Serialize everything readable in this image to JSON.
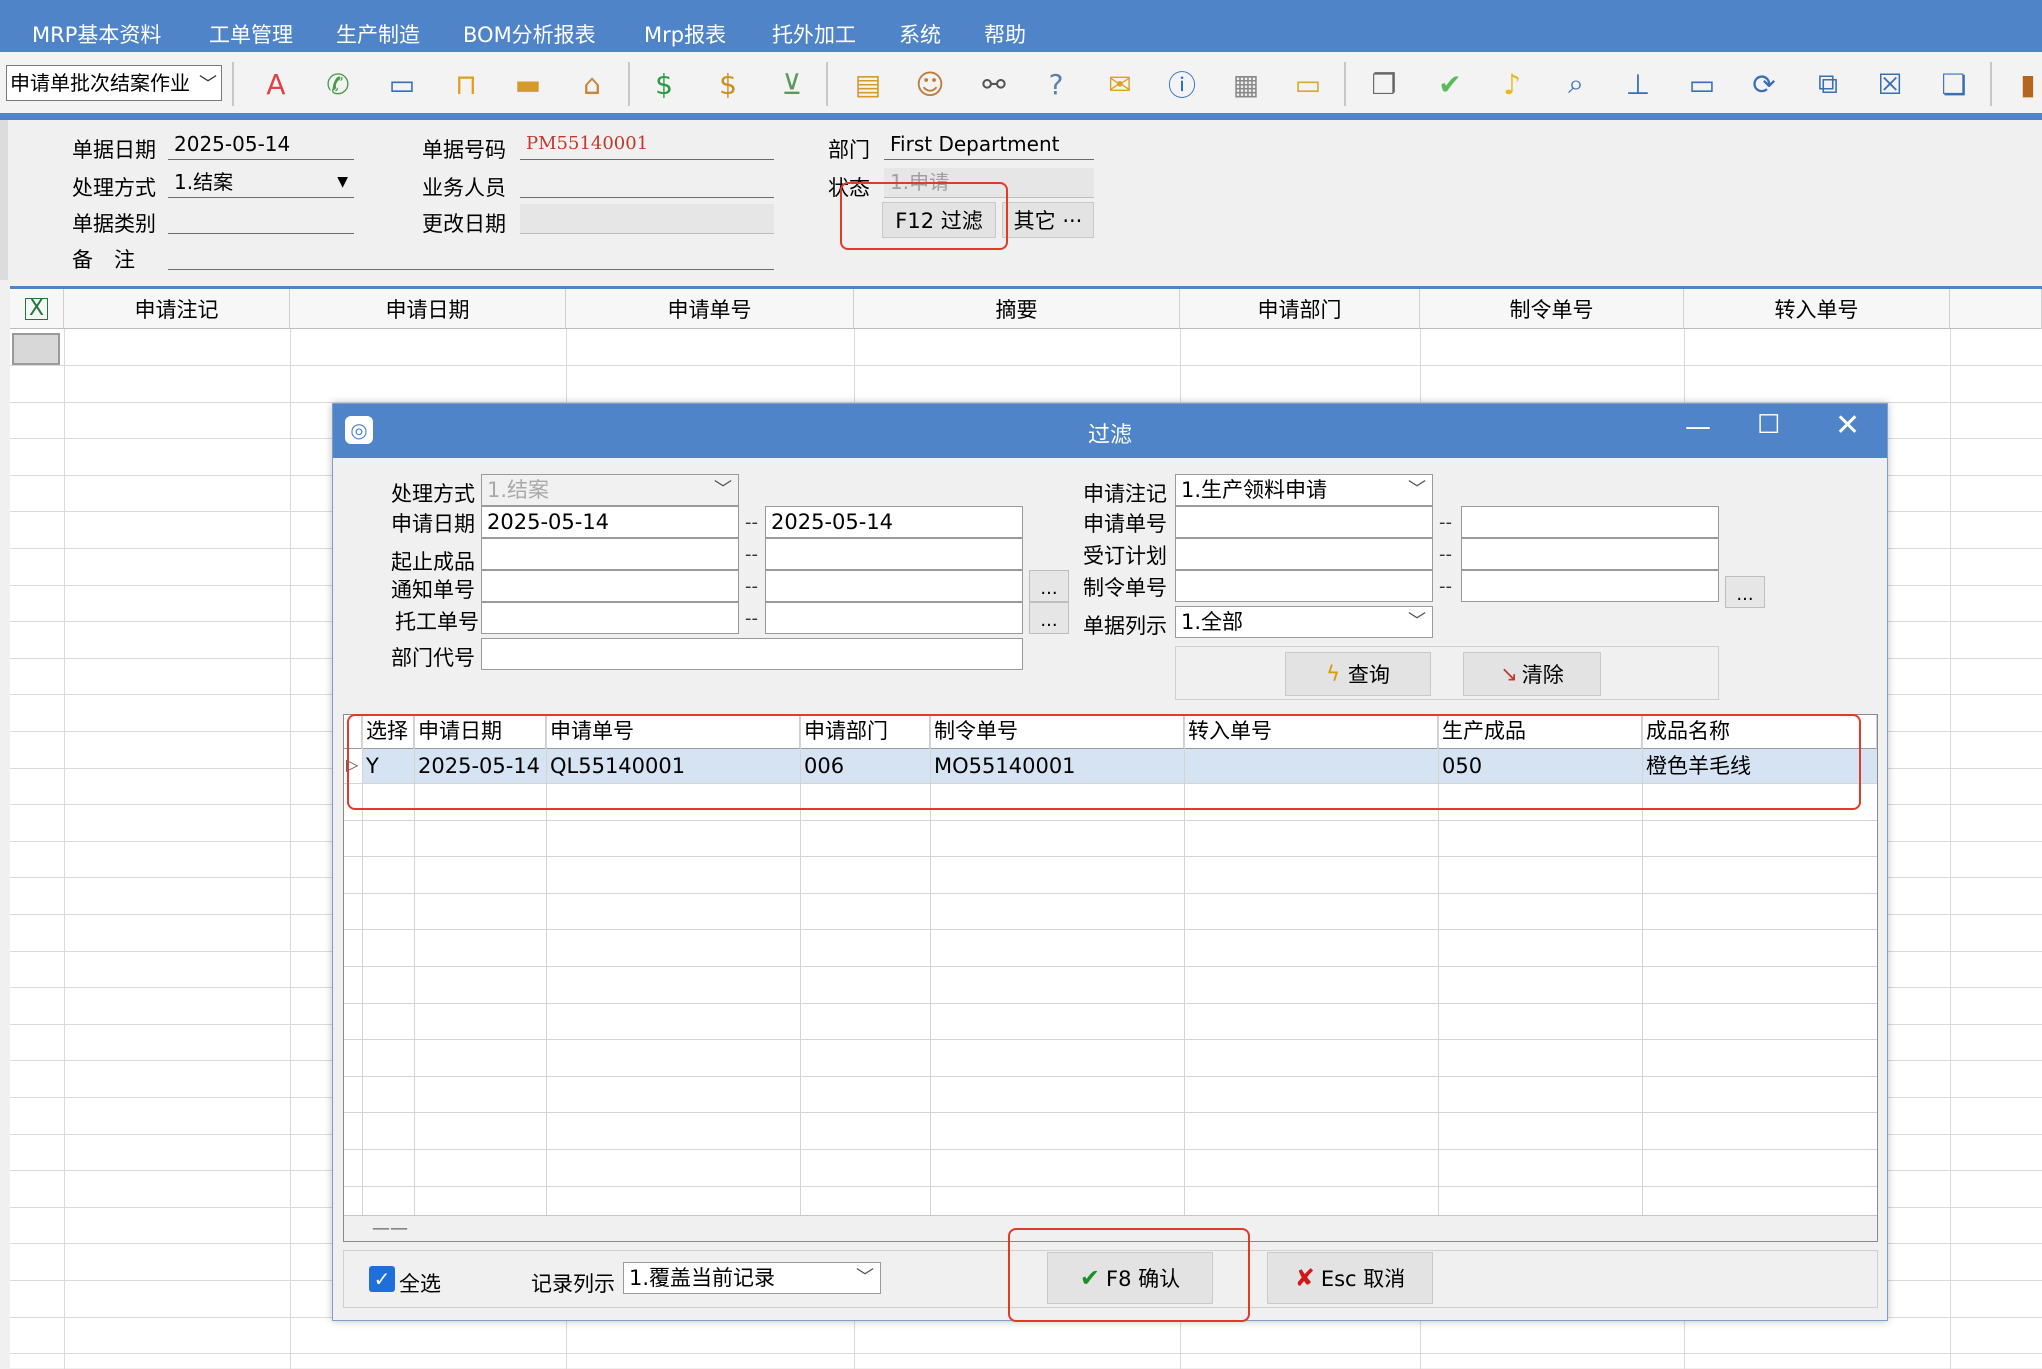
{
  "menu": [
    "MRP基本资料",
    "工单管理",
    "生产制造",
    "BOM分析报表",
    "Mrp报表",
    "托外加工",
    "系统",
    "帮助"
  ],
  "toolbar": {
    "combo_value": "申请单批次结案作业",
    "icons": [
      "spellcheck-icon",
      "phone-icon",
      "monitor-icon",
      "lock-icon",
      "briefcase-icon",
      "home-icon",
      "dollar-icon",
      "money-bag-icon",
      "cart-icon",
      "clipboard-icon",
      "users-icon",
      "link-icon",
      "help-doc-icon",
      "mail-icon",
      "info-icon",
      "calculator-icon",
      "folder-icon",
      "copy-doc-icon",
      "check-circle-icon",
      "bell-icon",
      "search-icon",
      "hierarchy-icon",
      "desktop-icon",
      "refresh-icon",
      "windows-icon",
      "close-box-icon",
      "restore-icon",
      "book-icon"
    ]
  },
  "form": {
    "date_label": "单据日期",
    "date_value": "2025-05-14",
    "no_label": "单据号码",
    "no_value": "PM55140001",
    "dept_label": "部门",
    "dept_value": "First Department",
    "process_label": "处理方式",
    "process_value": "1.结案",
    "staff_label": "业务人员",
    "staff_value": "",
    "status_label": "状态",
    "status_value": "1.申请",
    "type_label": "单据类别",
    "type_value": "",
    "modify_label": "更改日期",
    "modify_value": "",
    "remark_label": "备　注",
    "remark_value": "",
    "filter_button": "F12 过滤",
    "other_button": "其它 ···"
  },
  "main_grid": {
    "columns": [
      "申请注记",
      "申请日期",
      "申请单号",
      "摘要",
      "申请部门",
      "制令单号",
      "转入单号"
    ]
  },
  "dialog": {
    "title": "过滤",
    "process_label": "处理方式",
    "process_value": "1.结案",
    "apply_date_label": "申请日期",
    "apply_date_from": "2025-05-14",
    "apply_date_to": "2025-05-14",
    "product_label": "起止成品",
    "notice_label": "通知单号",
    "entrust_label": "托工单号",
    "deptcode_label": "部门代号",
    "apply_mark_label": "申请注记",
    "apply_mark_value": "1.生产领料申请",
    "apply_no_label": "申请单号",
    "order_plan_label": "受订计划",
    "mo_no_label": "制令单号",
    "list_label": "单据列示",
    "list_value": "1.全部",
    "ellipsis": "...",
    "query_button": "查询",
    "clear_button": "清除",
    "grid": {
      "columns": [
        "选择",
        "申请日期",
        "申请单号",
        "申请部门",
        "制令单号",
        "转入单号",
        "生产成品",
        "成品名称"
      ],
      "rows": [
        [
          "Y",
          "2025-05-14",
          "QL55140001",
          "006",
          "MO55140001",
          "",
          "050",
          "橙色羊毛线"
        ]
      ]
    },
    "select_all_label": "全选",
    "record_label": "记录列示",
    "record_value": "1.覆盖当前记录",
    "confirm_button": "F8 确认",
    "cancel_button": "Esc 取消"
  },
  "colors": {
    "accent": "#4f84c9",
    "highlight": "#e23a2a",
    "row_select": "#d5e3f3"
  }
}
